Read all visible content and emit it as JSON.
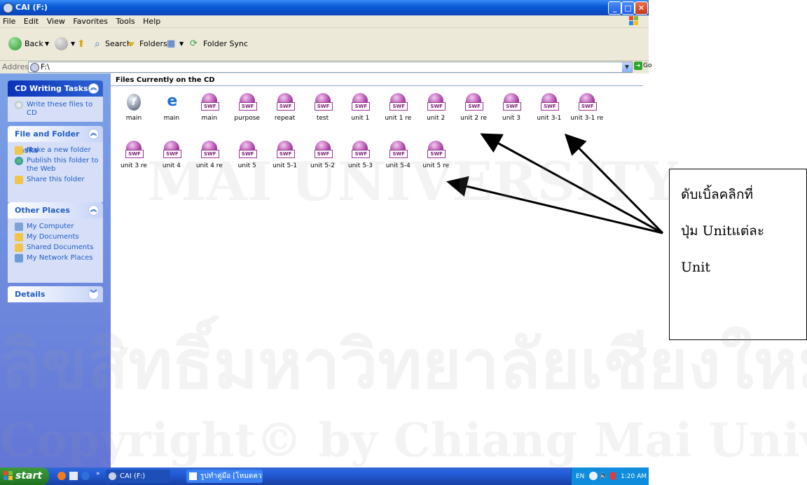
{
  "window": {
    "title": "CAI (F:)"
  },
  "menu": [
    "File",
    "Edit",
    "View",
    "Favorites",
    "Tools",
    "Help"
  ],
  "toolbar": {
    "back": "Back",
    "search": "Search",
    "folders": "Folders",
    "folder_sync": "Folder Sync"
  },
  "address": {
    "label": "Address",
    "value": "F:\\",
    "go": "Go"
  },
  "tasks": {
    "cd_writing": {
      "title": "CD Writing Tasks",
      "items": [
        "Write these files to CD"
      ]
    },
    "file_folder": {
      "title": "File and Folder Tasks",
      "items": [
        "Make a new folder",
        "Publish this folder to the Web",
        "Share this folder"
      ]
    },
    "other_places": {
      "title": "Other Places",
      "items": [
        "My Computer",
        "My Documents",
        "Shared Documents",
        "My Network Places"
      ]
    },
    "details": {
      "title": "Details"
    }
  },
  "main": {
    "section_title": "Files Currently on the CD",
    "files": [
      {
        "label": "main",
        "icon": "flash-icon"
      },
      {
        "label": "main",
        "icon": "ie-icon"
      },
      {
        "label": "main",
        "icon": "swf-icon"
      },
      {
        "label": "purpose",
        "icon": "swf-icon"
      },
      {
        "label": "repeat",
        "icon": "swf-icon"
      },
      {
        "label": "test",
        "icon": "swf-icon"
      },
      {
        "label": "unit 1",
        "icon": "swf-icon"
      },
      {
        "label": "unit 1 re",
        "icon": "swf-icon"
      },
      {
        "label": "unit 2",
        "icon": "swf-icon"
      },
      {
        "label": "unit 2 re",
        "icon": "swf-icon"
      },
      {
        "label": "unit 3",
        "icon": "swf-icon"
      },
      {
        "label": "unit 3-1",
        "icon": "swf-icon"
      },
      {
        "label": "unit 3-1 re",
        "icon": "swf-icon"
      },
      {
        "label": "unit 3 re",
        "icon": "swf-icon"
      },
      {
        "label": "unit 4",
        "icon": "swf-icon"
      },
      {
        "label": "unit 4 re",
        "icon": "swf-icon"
      },
      {
        "label": "unit 5",
        "icon": "swf-icon"
      },
      {
        "label": "unit 5-1",
        "icon": "swf-icon"
      },
      {
        "label": "unit 5-2",
        "icon": "swf-icon"
      },
      {
        "label": "unit 5-3",
        "icon": "swf-icon"
      },
      {
        "label": "unit 5-4",
        "icon": "swf-icon"
      },
      {
        "label": "unit 5 re",
        "icon": "swf-icon"
      }
    ]
  },
  "taskbar": {
    "start": "start",
    "tasks": [
      "CAI (F:)",
      "รูปทำคู่มือ [โหมดความ..."
    ],
    "tray_lang": "EN",
    "clock": "1:20 AM"
  },
  "annotation": {
    "lines": [
      "ดับเบิ้ลคลิกที่",
      "ปุ่ม Unitแต่ละ",
      "Unit"
    ]
  },
  "watermark": {
    "lines": [
      "ลิขสิทธิ์มหาวิทยาลัยเชียงใหม่",
      "Copyright© by Chiang Mai University",
      "MAI UNIVERSITY"
    ]
  },
  "colors": {
    "title_bar": "#0b5bd8",
    "task_pane": "#6375d6",
    "start_button": "#2f8a2f",
    "taskbar": "#245edb"
  }
}
